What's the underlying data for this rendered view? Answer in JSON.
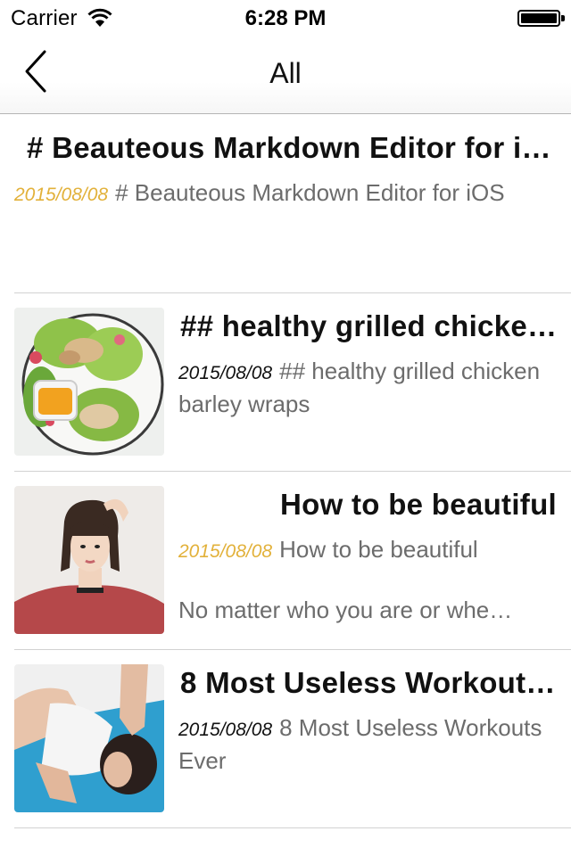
{
  "status_bar": {
    "carrier": "Carrier",
    "time": "6:28 PM",
    "wifi_icon": "wifi-icon",
    "battery_icon": "battery-icon"
  },
  "nav": {
    "title": "All",
    "back_icon": "chevron-left-icon"
  },
  "colors": {
    "date_gold": "#e2b13a",
    "text_gray": "#6c6c6c",
    "separator": "#d2d2d2"
  },
  "notes": [
    {
      "title": "# Beauteous Markdown Editor for i…",
      "date": "2015/08/08",
      "summary": "# Beauteous Markdown Editor for iOS",
      "thumbnail": ""
    },
    {
      "title": "## healthy grilled chicke…",
      "date": "2015/08/08",
      "summary": "## healthy grilled chicken barley wraps",
      "thumbnail": "salad-photo"
    },
    {
      "title": "How to be beautiful",
      "date": "2015/08/08",
      "summary": "How to be beautiful",
      "extra": "No matter who you are or whe…",
      "thumbnail": "woman-portrait-photo"
    },
    {
      "title": "8 Most Useless Workout…",
      "date": "2015/08/08",
      "summary": "8 Most Useless Workouts Ever",
      "thumbnail": "workout-photo"
    }
  ]
}
